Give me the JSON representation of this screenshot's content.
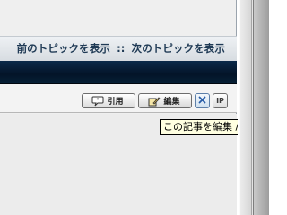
{
  "topic_nav": {
    "previous": "前のトピックを表示",
    "separator": "::",
    "next": "次のトピックを表示"
  },
  "post_buttons": {
    "quote_label": "引用",
    "edit_label": "編集",
    "delete_icon": "x-mark",
    "ip_label": "IP"
  },
  "tooltip": {
    "text": "この記事を編集 / 削除"
  },
  "colors": {
    "title_bar": "#041428",
    "nav_text": "#1f3a55",
    "tooltip_bg": "#ffffe1"
  }
}
